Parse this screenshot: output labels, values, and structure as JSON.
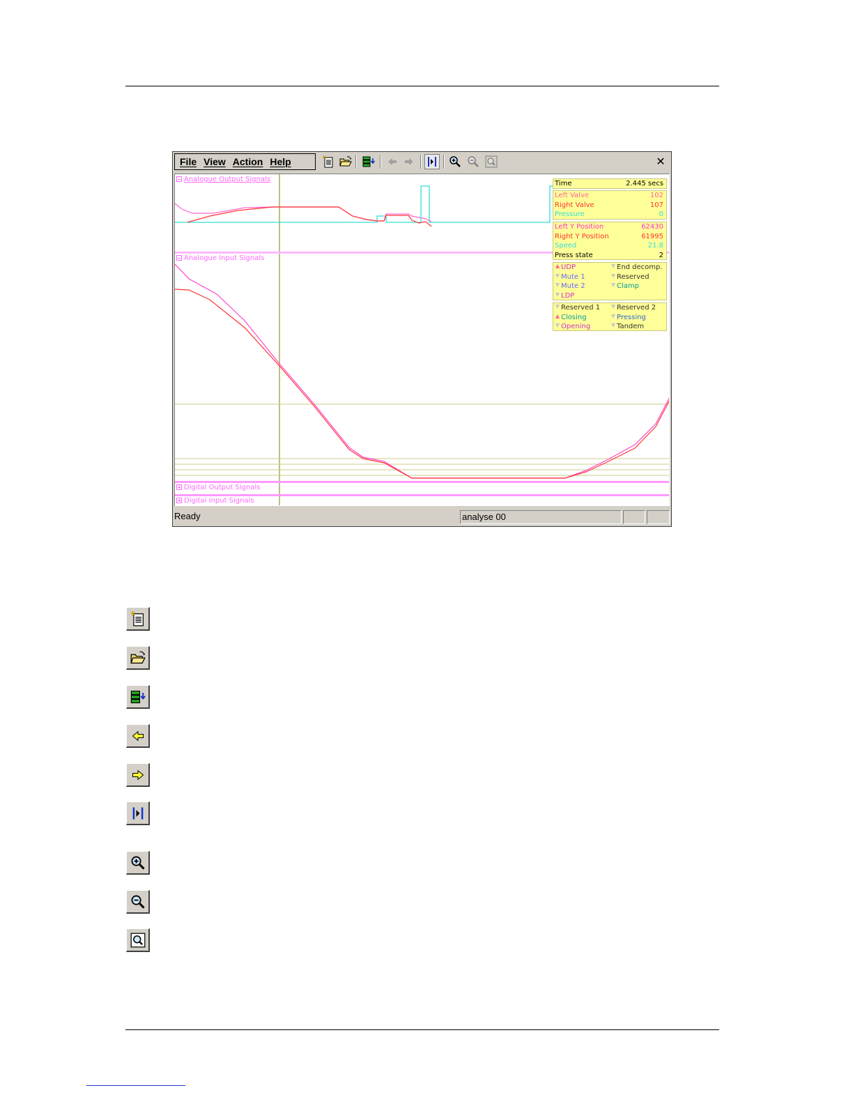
{
  "menu": {
    "file": "File",
    "view": "View",
    "action": "Action",
    "help": "Help"
  },
  "toolbar_icons": [
    "new-document-icon",
    "open-folder-icon",
    "download-data-icon",
    "arrow-left-icon",
    "arrow-right-icon",
    "jump-to-marker-icon",
    "zoom-in-icon",
    "zoom-out-icon",
    "zoom-fit-icon"
  ],
  "close_label": "✕",
  "sections": {
    "analogue_output": "Analogue Output Signals",
    "analogue_input": "Analogue Input Signals",
    "digital_output": "Digital Output Signals",
    "digital_input": "Digital Input Signals"
  },
  "info": {
    "time": {
      "label": "Time",
      "value": "2.445 secs"
    },
    "valves": [
      {
        "label": "Left Valve",
        "value": "102",
        "color": "#ff6699"
      },
      {
        "label": "Right Valve",
        "value": "107",
        "color": "#ff3333"
      },
      {
        "label": "Pressure",
        "value": "0",
        "color": "#33dddd"
      }
    ],
    "positions": [
      {
        "label": "Left Y Position",
        "value": "62430",
        "color": "#ff33cc"
      },
      {
        "label": "Right Y Position",
        "value": "61995",
        "color": "#ff3333"
      },
      {
        "label": "Speed",
        "value": "21.8",
        "color": "#33dddd"
      },
      {
        "label": "Press state",
        "value": "2",
        "color": "#000000"
      }
    ],
    "flags1": [
      {
        "label": "UDP",
        "state": "up",
        "color": "#cc33cc"
      },
      {
        "label": "End decomp.",
        "state": "down",
        "color": "#333333"
      },
      {
        "label": "Mute 1",
        "state": "down",
        "color": "#6666ff"
      },
      {
        "label": "Reserved",
        "state": "down",
        "color": "#333333"
      },
      {
        "label": "Mute 2",
        "state": "down",
        "color": "#6666ff"
      },
      {
        "label": "Clamp",
        "state": "down",
        "color": "#009999"
      },
      {
        "label": "LDP",
        "state": "down",
        "color": "#cc33cc"
      }
    ],
    "flags2": [
      {
        "label": "Reserved 1",
        "state": "down",
        "color": "#333333"
      },
      {
        "label": "Reserved 2",
        "state": "down",
        "color": "#333333"
      },
      {
        "label": "Closing",
        "state": "up",
        "color": "#009999"
      },
      {
        "label": "Pressing",
        "state": "down",
        "color": "#3366cc"
      },
      {
        "label": "Opening",
        "state": "down",
        "color": "#cc33cc"
      },
      {
        "label": "Tandem",
        "state": "down",
        "color": "#333333"
      }
    ]
  },
  "status": {
    "ready": "Ready",
    "file": "analyse 00"
  },
  "legend_icons": [
    "new-document-icon",
    "open-folder-icon",
    "download-data-icon",
    "arrow-left-icon",
    "arrow-right-icon",
    "jump-to-marker-icon",
    "zoom-in-icon",
    "zoom-out-icon",
    "zoom-fit-icon"
  ]
}
